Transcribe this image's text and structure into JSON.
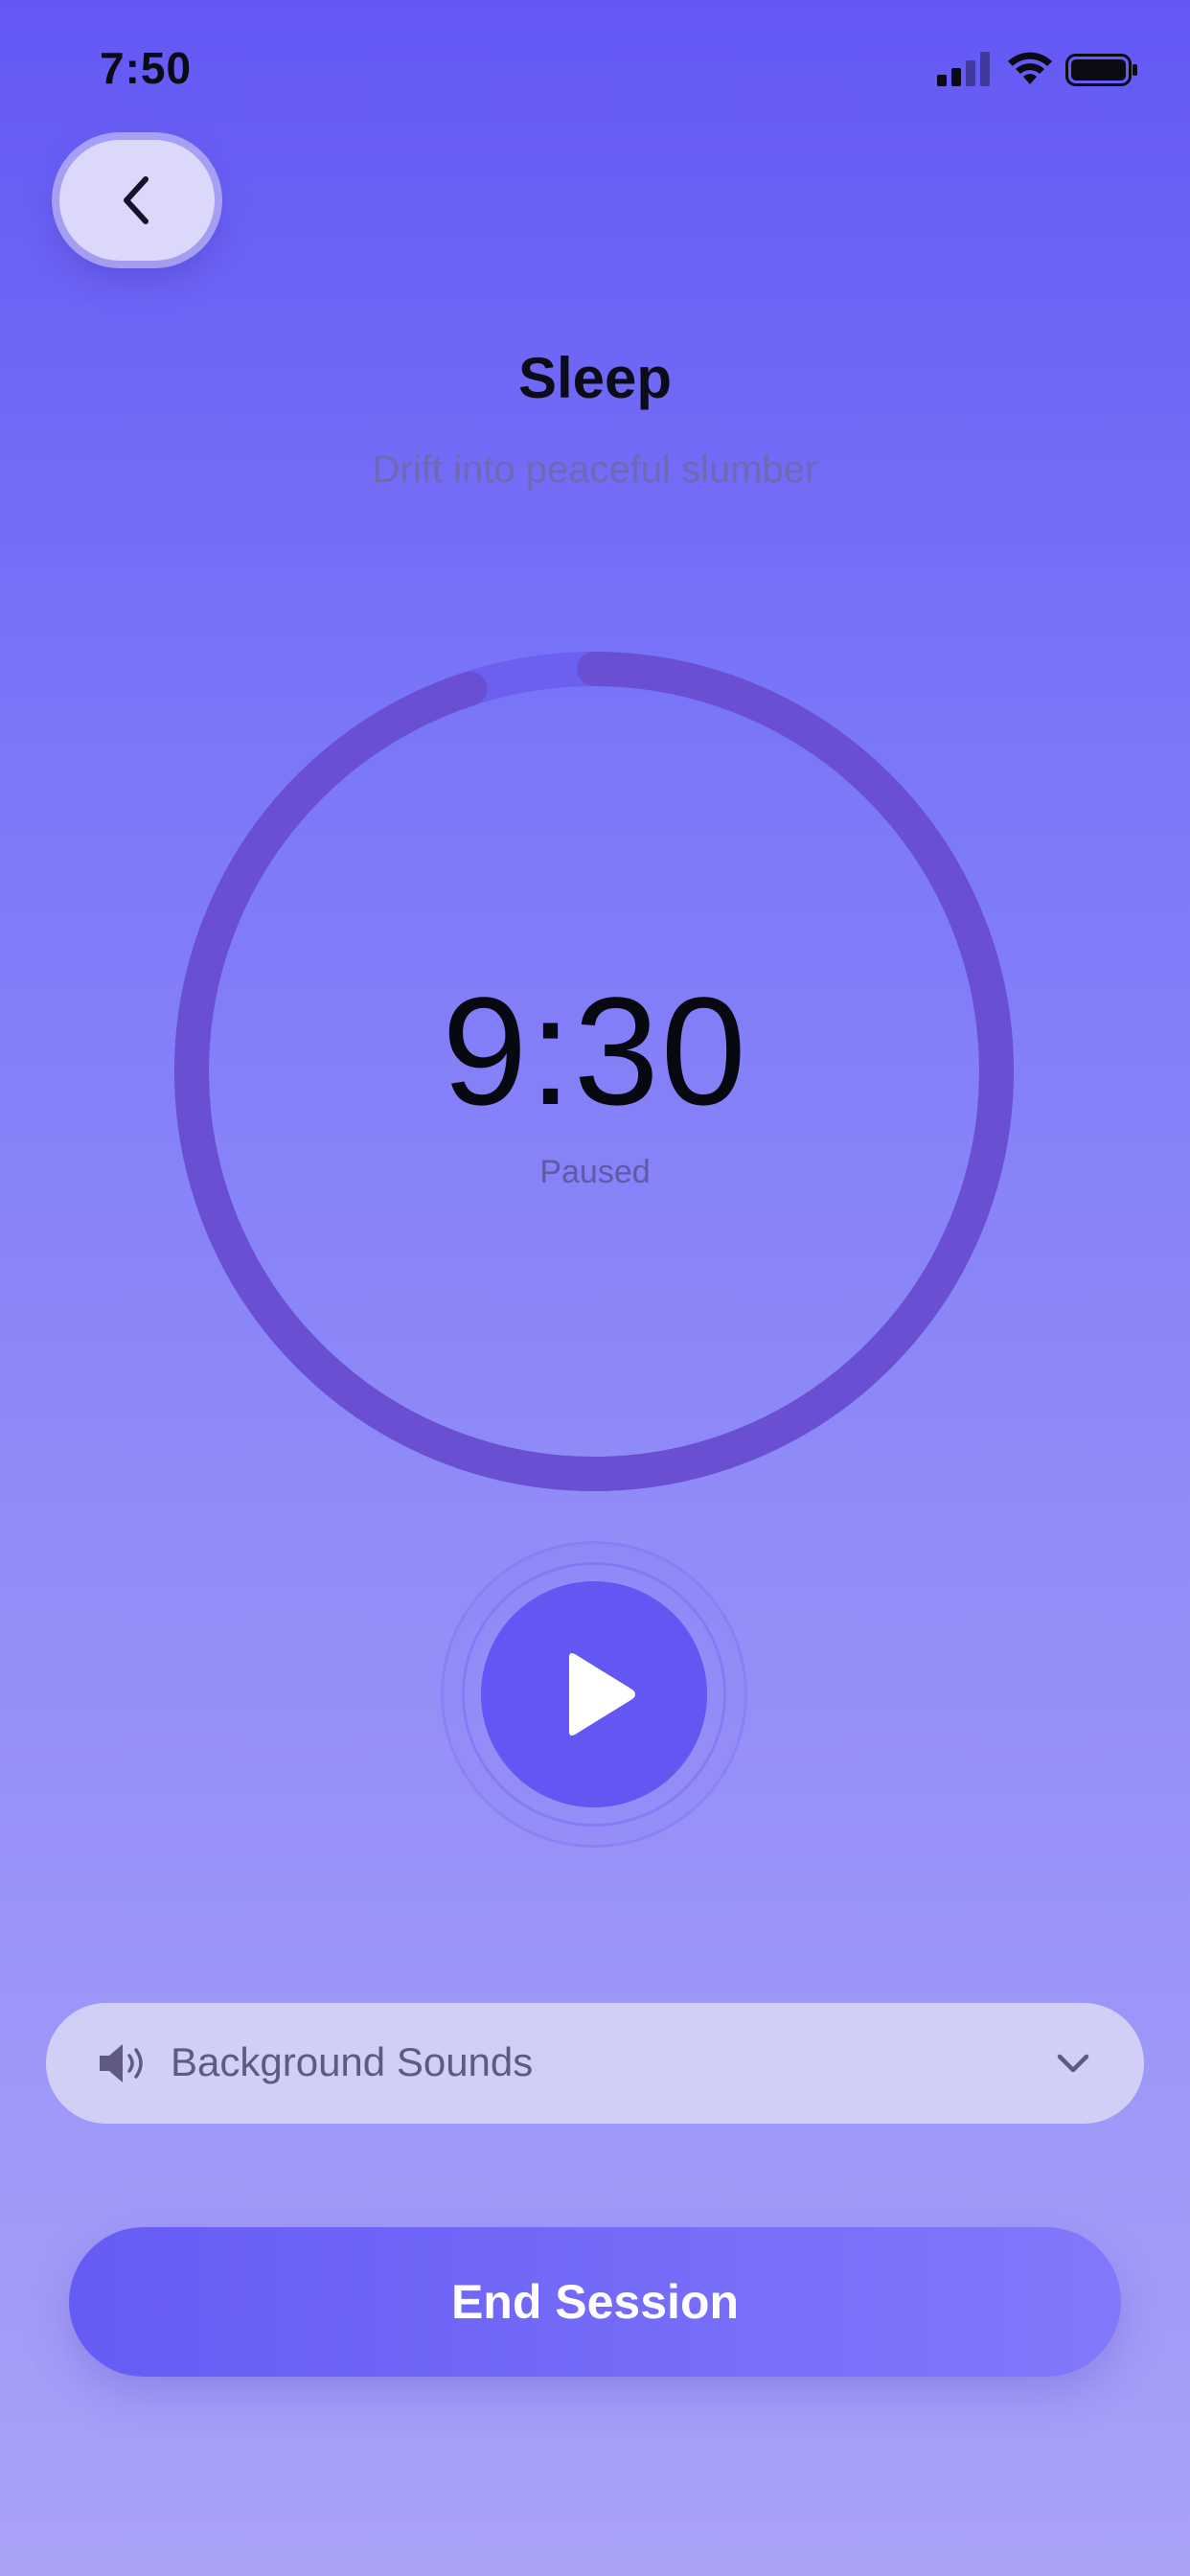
{
  "status_bar": {
    "time": "7:50"
  },
  "header": {
    "title": "Sleep",
    "subtitle": "Drift into peaceful slumber"
  },
  "timer": {
    "time": "9:30",
    "status": "Paused",
    "progress": 0.95
  },
  "background_sounds": {
    "label": "Background Sounds"
  },
  "actions": {
    "end_session": "End Session"
  },
  "colors": {
    "accent": "#6257f3",
    "ring": "#6a4fd2",
    "ring_track": "#6c60f0"
  }
}
